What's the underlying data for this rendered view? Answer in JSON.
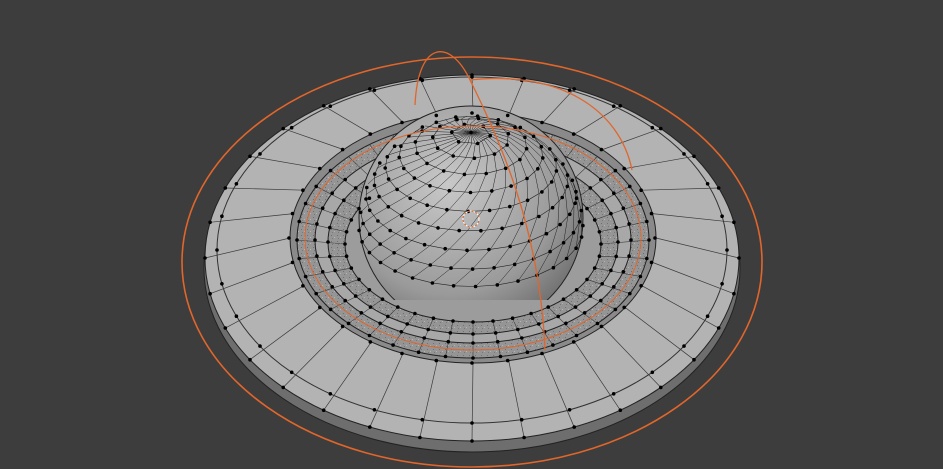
{
  "viewport": {
    "colors": {
      "background": "#3d3d3d",
      "mesh_face": "#a9a9a9",
      "mesh_face_light": "#bdbdbd",
      "mesh_side": "#7a7a7a",
      "edge": "#1a1a1a",
      "vertex": "#000000",
      "selection_outline": "#e0662b",
      "textured_band": "#8f8f8f"
    },
    "mesh": {
      "outer_ring_segments": 32,
      "inner_ring_segments": 40,
      "dome_rings": 9,
      "dome_segments": 32
    },
    "icons": [
      "origin-gizmo-icon"
    ]
  }
}
